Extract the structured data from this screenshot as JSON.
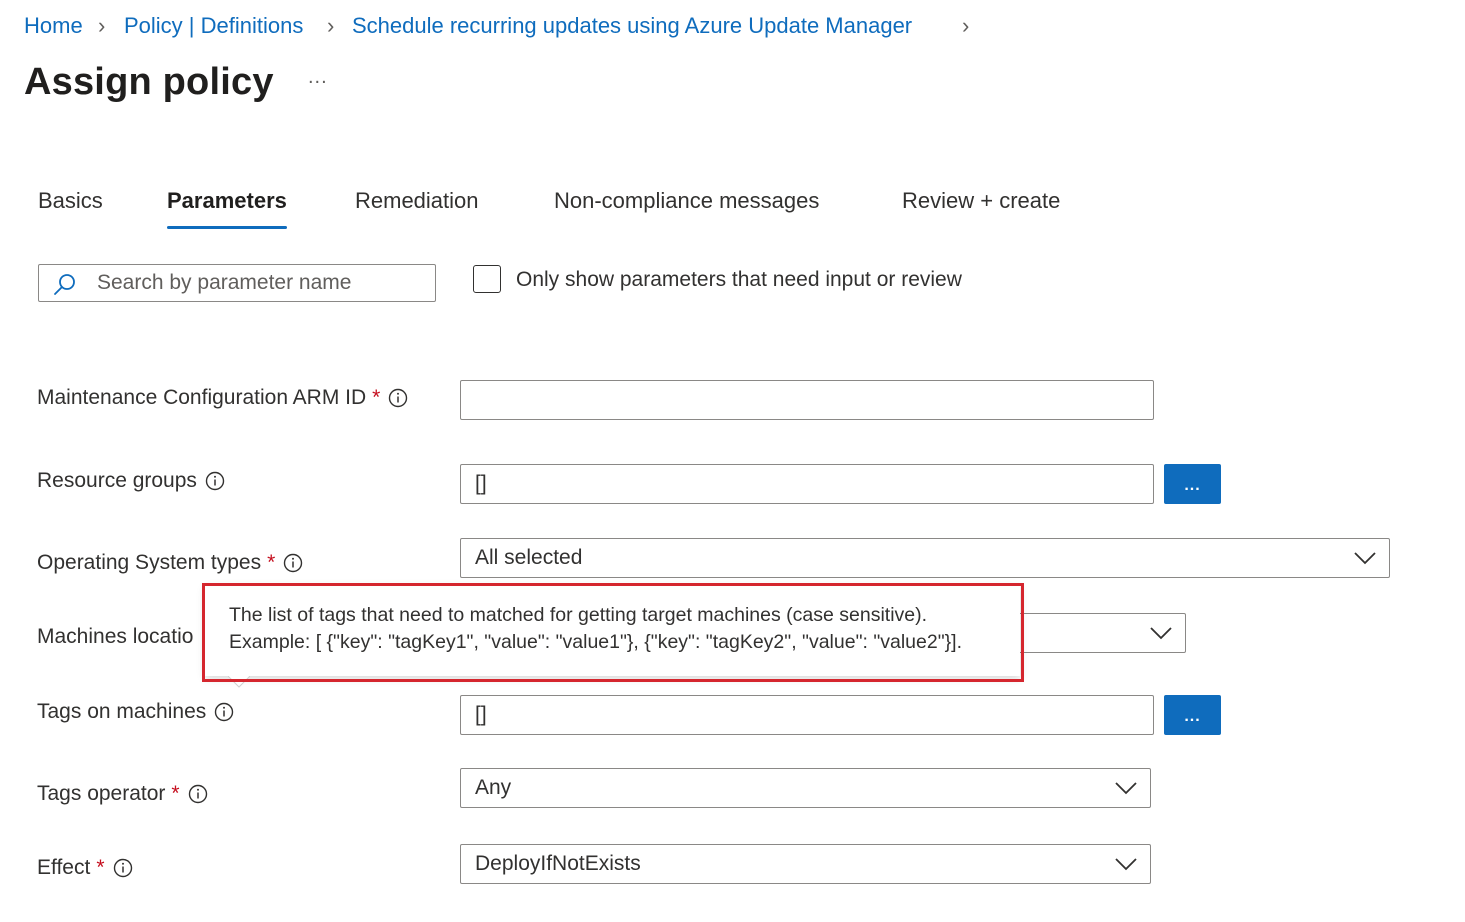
{
  "breadcrumb": {
    "items": [
      "Home",
      "Policy | Definitions",
      "Schedule recurring updates using Azure Update Manager"
    ]
  },
  "page": {
    "title": "Assign policy",
    "more": "..."
  },
  "tabs": [
    {
      "label": "Basics",
      "active": false
    },
    {
      "label": "Parameters",
      "active": true
    },
    {
      "label": "Remediation",
      "active": false
    },
    {
      "label": "Non-compliance messages",
      "active": false
    },
    {
      "label": "Review + create",
      "active": false
    }
  ],
  "search": {
    "placeholder": "Search by parameter name",
    "value": ""
  },
  "filter": {
    "label": "Only show parameters that need input or review",
    "checked": false
  },
  "params": {
    "maintenance_config": {
      "label": "Maintenance Configuration ARM ID",
      "required": "*",
      "value": ""
    },
    "resource_groups": {
      "label": "Resource groups",
      "value": "[]",
      "button": "..."
    },
    "os_types": {
      "label": "Operating System types",
      "required": "*",
      "value": "All selected"
    },
    "machines_locations": {
      "label": "Machines locatio"
    },
    "tags_on_machines": {
      "label": "Tags on machines",
      "value": "[]",
      "button": "..."
    },
    "tags_operator": {
      "label": "Tags operator",
      "required": "*",
      "value": "Any"
    },
    "effect": {
      "label": "Effect",
      "required": "*",
      "value": "DeployIfNotExists"
    }
  },
  "tooltip": {
    "line1": "The list of tags that need to matched for getting target machines (case sensitive).",
    "line2": "Example: [ {\"key\": \"tagKey1\", \"value\": \"value1\"}, {\"key\": \"tagKey2\", \"value\": \"value2\"}].",
    "highlight_color": "#d5262e"
  },
  "colors": {
    "accent": "#0f6cbd",
    "required": "#c50f1f"
  }
}
